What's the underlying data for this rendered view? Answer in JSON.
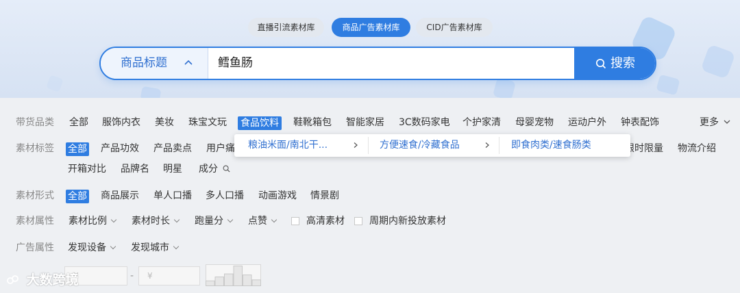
{
  "tabs": [
    "直播引流素材库",
    "商品广告素材库",
    "CID广告素材库"
  ],
  "search": {
    "type_label": "商品标题",
    "value": "鳕鱼肠",
    "button_label": "搜索"
  },
  "category_row": {
    "label": "带货品类",
    "items": [
      "全部",
      "服饰内衣",
      "美妆",
      "珠宝文玩",
      "食品饮料",
      "鞋靴箱包",
      "智能家居",
      "3C数码家电",
      "个护家清",
      "母婴宠物",
      "运动户外",
      "钟表配饰"
    ],
    "selected": "食品饮料",
    "more_label": "更多"
  },
  "tag_row": {
    "label": "素材标签",
    "items_line1": [
      "全部",
      "产品功效",
      "产品卖点",
      "用户痛"
    ],
    "items_line1_right": [
      "限时限量",
      "物流介绍"
    ],
    "items_line2": [
      "开箱对比",
      "品牌名",
      "明星",
      "成分"
    ],
    "selected": "全部"
  },
  "category_popover": {
    "levels": [
      "粮油米面/南北干...",
      "方便速食/冷藏食品",
      "即食肉类/速食肠类"
    ]
  },
  "form_row": {
    "label": "素材形式",
    "items": [
      "全部",
      "商品展示",
      "单人口播",
      "多人口播",
      "动画游戏",
      "情景剧"
    ],
    "selected": "全部"
  },
  "attr_row": {
    "label": "素材属性",
    "dropdowns": [
      "素材比例",
      "素材时长",
      "跑量分",
      "点赞"
    ],
    "checkboxes": [
      "高清素材",
      "周期内新投放素材"
    ]
  },
  "ad_row": {
    "label": "广告属性",
    "dropdowns": [
      "发现设备",
      "发现城市"
    ]
  },
  "price_row": {
    "min_placeholder": "¥",
    "max_placeholder": "¥",
    "dash": "-",
    "distribution": [
      0.25,
      0.45,
      0.6,
      1.0,
      0.55,
      0.3
    ]
  },
  "watermark": "大数跨境",
  "colors": {
    "accent": "#2f7de1",
    "label_gray": "#888888",
    "page_bg": "#eef0f3"
  }
}
